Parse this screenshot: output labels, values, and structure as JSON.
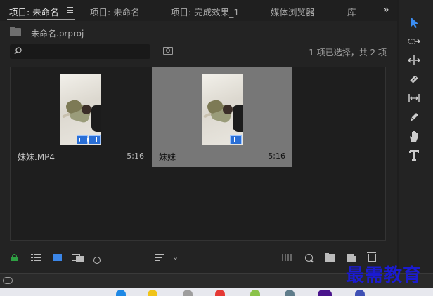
{
  "tabs": [
    {
      "label": "项目: 未命名",
      "active": true
    },
    {
      "label": "项目: 未命名",
      "active": false
    },
    {
      "label": "项目: 完成效果_1",
      "active": false
    },
    {
      "label": "媒体浏览器",
      "active": false
    },
    {
      "label": "库",
      "active": false
    }
  ],
  "tab_menu_icon": "hamburger-menu-icon",
  "tab_overflow_icon": "double-chevron-right-icon",
  "bin": {
    "path": "未命名.prproj",
    "icon": "bin-folder-icon"
  },
  "search": {
    "value": "",
    "placeholder": "",
    "icon": "magnifier-icon"
  },
  "selection_status": "1 项已选择，共 2 项",
  "items": [
    {
      "name": "妹妹.MP4",
      "duration": "5;16",
      "selected": false,
      "badges": [
        "video-audio-badge",
        "audio-waveform-badge"
      ]
    },
    {
      "name": "妹妹",
      "duration": "5;16",
      "selected": true,
      "badges": [
        "sequence-badge"
      ]
    }
  ],
  "bottom_toolbar": {
    "icons": [
      "lock-icon",
      "list-view-icon",
      "icon-view-icon",
      "freeform-view-icon",
      "zoom-slider",
      "sort-icon",
      "chevron-down-icon",
      "automate-to-sequence-icon",
      "find-icon",
      "new-bin-icon",
      "new-item-icon",
      "trash-icon"
    ],
    "zoom_level": 0
  },
  "tools": [
    "selection-tool-icon",
    "track-select-tool-icon",
    "ripple-edit-tool-icon",
    "razor-tool-icon",
    "slip-tool-icon",
    "pen-tool-icon",
    "hand-tool-icon",
    "type-tool-icon"
  ],
  "watermark": "最需教育",
  "colors": {
    "accent_blue": "#2b7de9",
    "lock_green": "#2ea043",
    "selected_tile": "#777777",
    "watermark_blue": "#1b1bd0"
  }
}
